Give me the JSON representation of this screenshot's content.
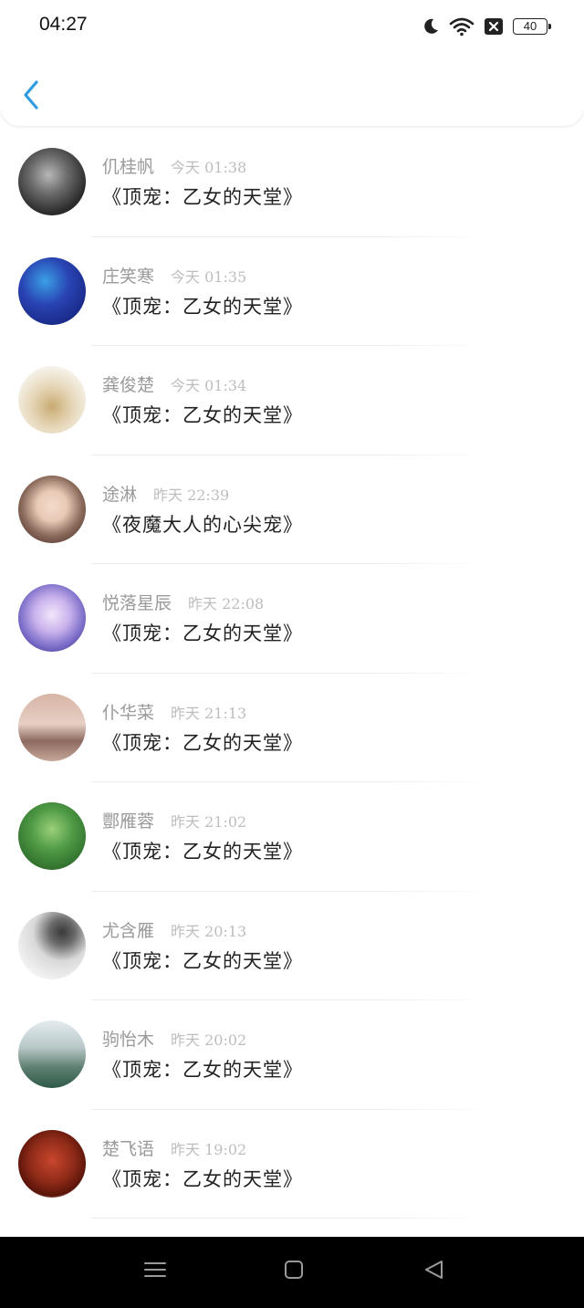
{
  "status_bar": {
    "time": "04:27",
    "battery": "40"
  },
  "list": [
    {
      "name": "仉桂帆",
      "time": "今天 01:38",
      "title": "《顶宠：乙女的天堂》",
      "colors": [
        "#2b2b2b",
        "#b7b7b7"
      ]
    },
    {
      "name": "庄笑寒",
      "time": "今天 01:35",
      "title": "《顶宠：乙女的天堂》",
      "colors": [
        "#1a2a8a",
        "#3aa0e6"
      ]
    },
    {
      "name": "龚俊楚",
      "time": "今天 01:34",
      "title": "《顶宠：乙女的天堂》",
      "colors": [
        "#f3eadf",
        "#c9ab73"
      ]
    },
    {
      "name": "途淋",
      "time": "昨天 22:39",
      "title": "《夜魔大人的心尖宠》",
      "colors": [
        "#5a3a35",
        "#e7c9b6"
      ]
    },
    {
      "name": "悦落星辰",
      "time": "昨天 22:08",
      "title": "《顶宠：乙女的天堂》",
      "colors": [
        "#5b55b8",
        "#e0cdf2"
      ]
    },
    {
      "name": "仆华菜",
      "time": "昨天 21:13",
      "title": "《顶宠：乙女的天堂》",
      "colors": [
        "#d9b8a8",
        "#8d6a5f"
      ]
    },
    {
      "name": "酆雁蓉",
      "time": "昨天 21:02",
      "title": "《顶宠：乙女的天堂》",
      "colors": [
        "#2d6b2a",
        "#9bd07a"
      ]
    },
    {
      "name": "尤含雁",
      "time": "昨天 20:13",
      "title": "《顶宠：乙女的天堂》",
      "colors": [
        "#f1f1f1",
        "#3a3a3a"
      ]
    },
    {
      "name": "驹怡木",
      "time": "昨天 20:02",
      "title": "《顶宠：乙女的天堂》",
      "colors": [
        "#e4ecef",
        "#2f5a48"
      ]
    },
    {
      "name": "楚飞语",
      "time": "昨天 19:02",
      "title": "《顶宠：乙女的天堂》",
      "colors": [
        "#7a1b12",
        "#c8462d"
      ]
    }
  ]
}
